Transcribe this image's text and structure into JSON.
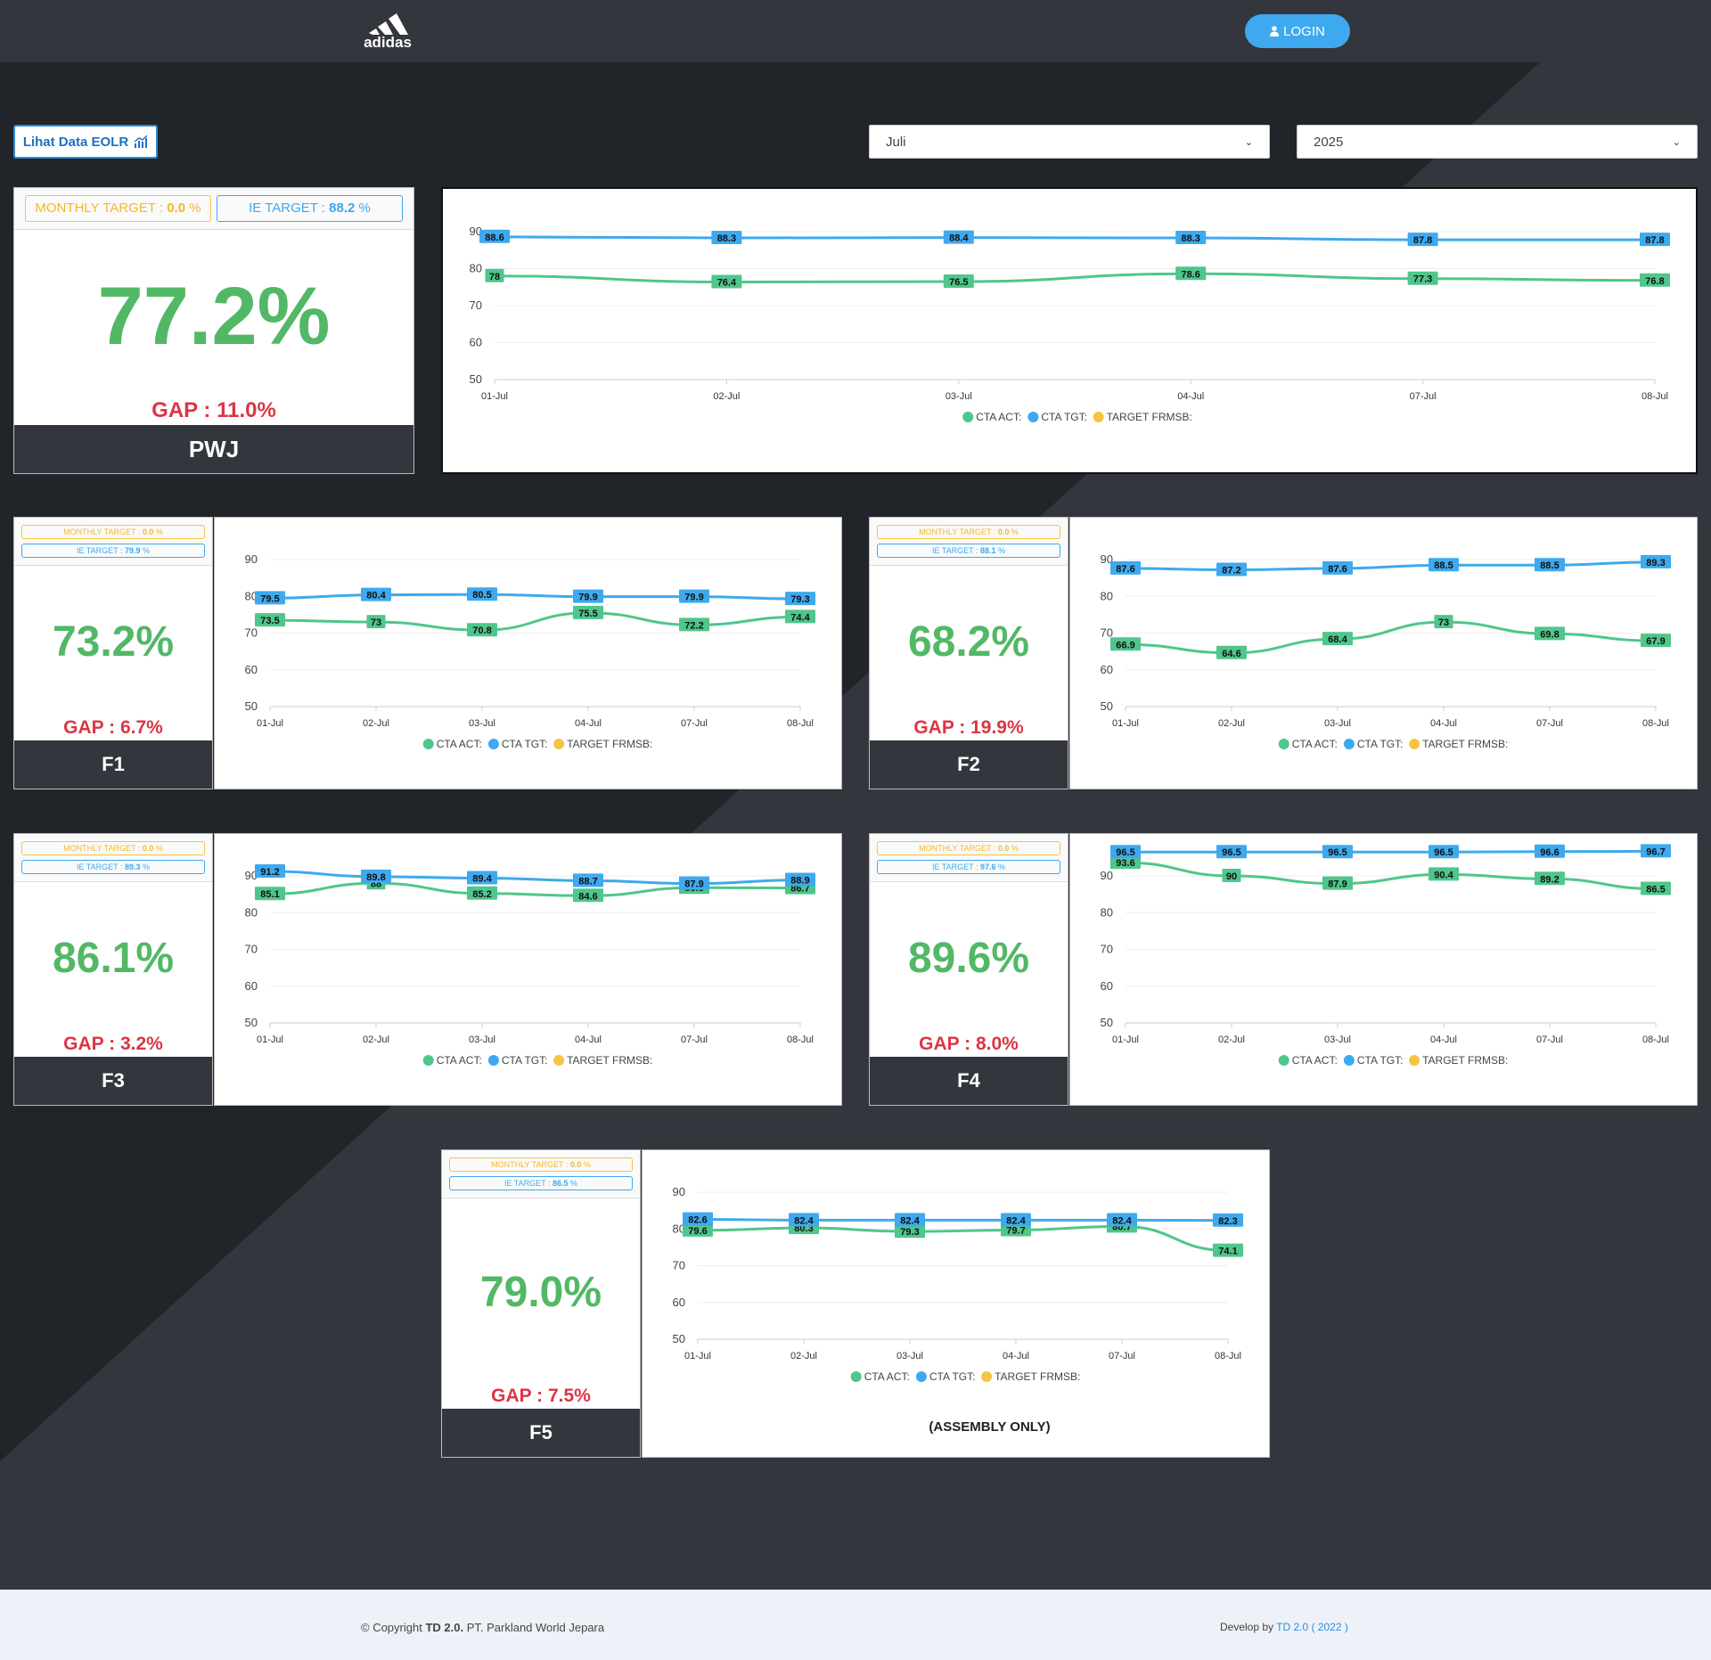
{
  "header": {
    "logo_text": "adidas",
    "login_label": "LOGIN"
  },
  "controls": {
    "eolr_button_label": "Lihat Data EOLR",
    "month_selected": "Juli",
    "year_selected": "2025"
  },
  "legend": [
    "CTA ACT:",
    "CTA TGT:",
    "TARGET FRMSB:"
  ],
  "colors": {
    "act": "#4fc68b",
    "tgt": "#3ea9ee",
    "frmsb": "#f6c342",
    "big": "#52b866",
    "gap": "#dc3545"
  },
  "panels": [
    {
      "name": "PWJ",
      "monthly_target_label": "MONTHLY TARGET :",
      "monthly_target_value": "0.0",
      "ie_target_label": "IE TARGET :",
      "ie_target_value": "88.2",
      "percent_unit": "%",
      "big_value": "77.2%",
      "gap": "GAP : 11.0%",
      "note": ""
    },
    {
      "name": "F1",
      "monthly_target_label": "MONTHLY TARGET :",
      "monthly_target_value": "0.0",
      "ie_target_label": "IE TARGET :",
      "ie_target_value": "79.9",
      "percent_unit": "%",
      "big_value": "73.2%",
      "gap": "GAP : 6.7%",
      "note": ""
    },
    {
      "name": "F2",
      "monthly_target_label": "MONTHLY TARGET :",
      "monthly_target_value": "0.0",
      "ie_target_label": "IE TARGET :",
      "ie_target_value": "88.1",
      "percent_unit": "%",
      "big_value": "68.2%",
      "gap": "GAP : 19.9%",
      "note": ""
    },
    {
      "name": "F3",
      "monthly_target_label": "MONTHLY TARGET :",
      "monthly_target_value": "0.0",
      "ie_target_label": "IE TARGET :",
      "ie_target_value": "89.3",
      "percent_unit": "%",
      "big_value": "86.1%",
      "gap": "GAP : 3.2%",
      "note": ""
    },
    {
      "name": "F4",
      "monthly_target_label": "MONTHLY TARGET :",
      "monthly_target_value": "0.0",
      "ie_target_label": "IE TARGET :",
      "ie_target_value": "97.6",
      "percent_unit": "%",
      "big_value": "89.6%",
      "gap": "GAP : 8.0%",
      "note": ""
    },
    {
      "name": "F5",
      "monthly_target_label": "MONTHLY TARGET :",
      "monthly_target_value": "0.0",
      "ie_target_label": "IE TARGET :",
      "ie_target_value": "86.5",
      "percent_unit": "%",
      "big_value": "79.0%",
      "gap": "GAP : 7.5%",
      "note": "(ASSEMBLY ONLY)"
    }
  ],
  "chart_data": [
    {
      "type": "line",
      "categories": [
        "01-Jul",
        "02-Jul",
        "03-Jul",
        "04-Jul",
        "07-Jul",
        "08-Jul"
      ],
      "yticks": [
        50,
        60,
        70,
        80,
        90
      ],
      "ylim": [
        50,
        90
      ],
      "legend_position": "bottom",
      "series": [
        {
          "name": "CTA ACT:",
          "values": [
            78,
            76.4,
            76.5,
            78.6,
            77.3,
            76.8
          ]
        },
        {
          "name": "CTA TGT:",
          "values": [
            88.6,
            88.3,
            88.4,
            88.3,
            87.8,
            87.8
          ]
        }
      ]
    },
    {
      "type": "line",
      "categories": [
        "01-Jul",
        "02-Jul",
        "03-Jul",
        "04-Jul",
        "07-Jul",
        "08-Jul"
      ],
      "yticks": [
        50,
        60,
        70,
        80,
        90
      ],
      "ylim": [
        50,
        90
      ],
      "legend_position": "bottom",
      "series": [
        {
          "name": "CTA ACT:",
          "values": [
            73.5,
            73,
            70.8,
            75.5,
            72.2,
            74.4
          ]
        },
        {
          "name": "CTA TGT:",
          "values": [
            79.5,
            80.4,
            80.5,
            79.9,
            79.9,
            79.3
          ]
        }
      ]
    },
    {
      "type": "line",
      "categories": [
        "01-Jul",
        "02-Jul",
        "03-Jul",
        "04-Jul",
        "07-Jul",
        "08-Jul"
      ],
      "yticks": [
        50,
        60,
        70,
        80,
        90
      ],
      "ylim": [
        50,
        90
      ],
      "legend_position": "bottom",
      "series": [
        {
          "name": "CTA ACT:",
          "values": [
            66.9,
            64.6,
            68.4,
            73,
            69.8,
            67.9
          ]
        },
        {
          "name": "CTA TGT:",
          "values": [
            87.6,
            87.2,
            87.6,
            88.5,
            88.5,
            89.3
          ]
        }
      ]
    },
    {
      "type": "line",
      "categories": [
        "01-Jul",
        "02-Jul",
        "03-Jul",
        "04-Jul",
        "07-Jul",
        "08-Jul"
      ],
      "yticks": [
        50,
        60,
        70,
        80,
        90
      ],
      "ylim": [
        50,
        90
      ],
      "legend_position": "bottom",
      "series": [
        {
          "name": "CTA ACT:",
          "values": [
            85.1,
            88,
            85.2,
            84.6,
            86.8,
            86.7
          ]
        },
        {
          "name": "CTA TGT:",
          "values": [
            91.2,
            89.8,
            89.4,
            88.7,
            87.9,
            88.9
          ]
        }
      ]
    },
    {
      "type": "line",
      "categories": [
        "01-Jul",
        "02-Jul",
        "03-Jul",
        "04-Jul",
        "07-Jul",
        "08-Jul"
      ],
      "yticks": [
        50,
        60,
        70,
        80,
        90
      ],
      "ylim": [
        50,
        90
      ],
      "legend_position": "bottom",
      "series": [
        {
          "name": "CTA ACT:",
          "values": [
            93.6,
            90,
            87.9,
            90.4,
            89.2,
            86.5
          ]
        },
        {
          "name": "CTA TGT:",
          "values": [
            96.5,
            96.5,
            96.5,
            96.5,
            96.6,
            96.7
          ]
        }
      ]
    },
    {
      "type": "line",
      "categories": [
        "01-Jul",
        "02-Jul",
        "03-Jul",
        "04-Jul",
        "07-Jul",
        "08-Jul"
      ],
      "yticks": [
        50,
        60,
        70,
        80,
        90
      ],
      "ylim": [
        50,
        90
      ],
      "legend_position": "bottom",
      "series": [
        {
          "name": "CTA ACT:",
          "values": [
            79.6,
            80.3,
            79.3,
            79.7,
            80.7,
            74.1
          ]
        },
        {
          "name": "CTA TGT:",
          "values": [
            82.6,
            82.4,
            82.4,
            82.4,
            82.4,
            82.3
          ]
        }
      ]
    }
  ],
  "footer": {
    "copyright_prefix": "© Copyright",
    "brand": "TD 2.0.",
    "company": "PT. Parkland World Jepara",
    "develop_prefix": "Develop by",
    "develop_link": "TD 2.0 ( 2022 )"
  }
}
